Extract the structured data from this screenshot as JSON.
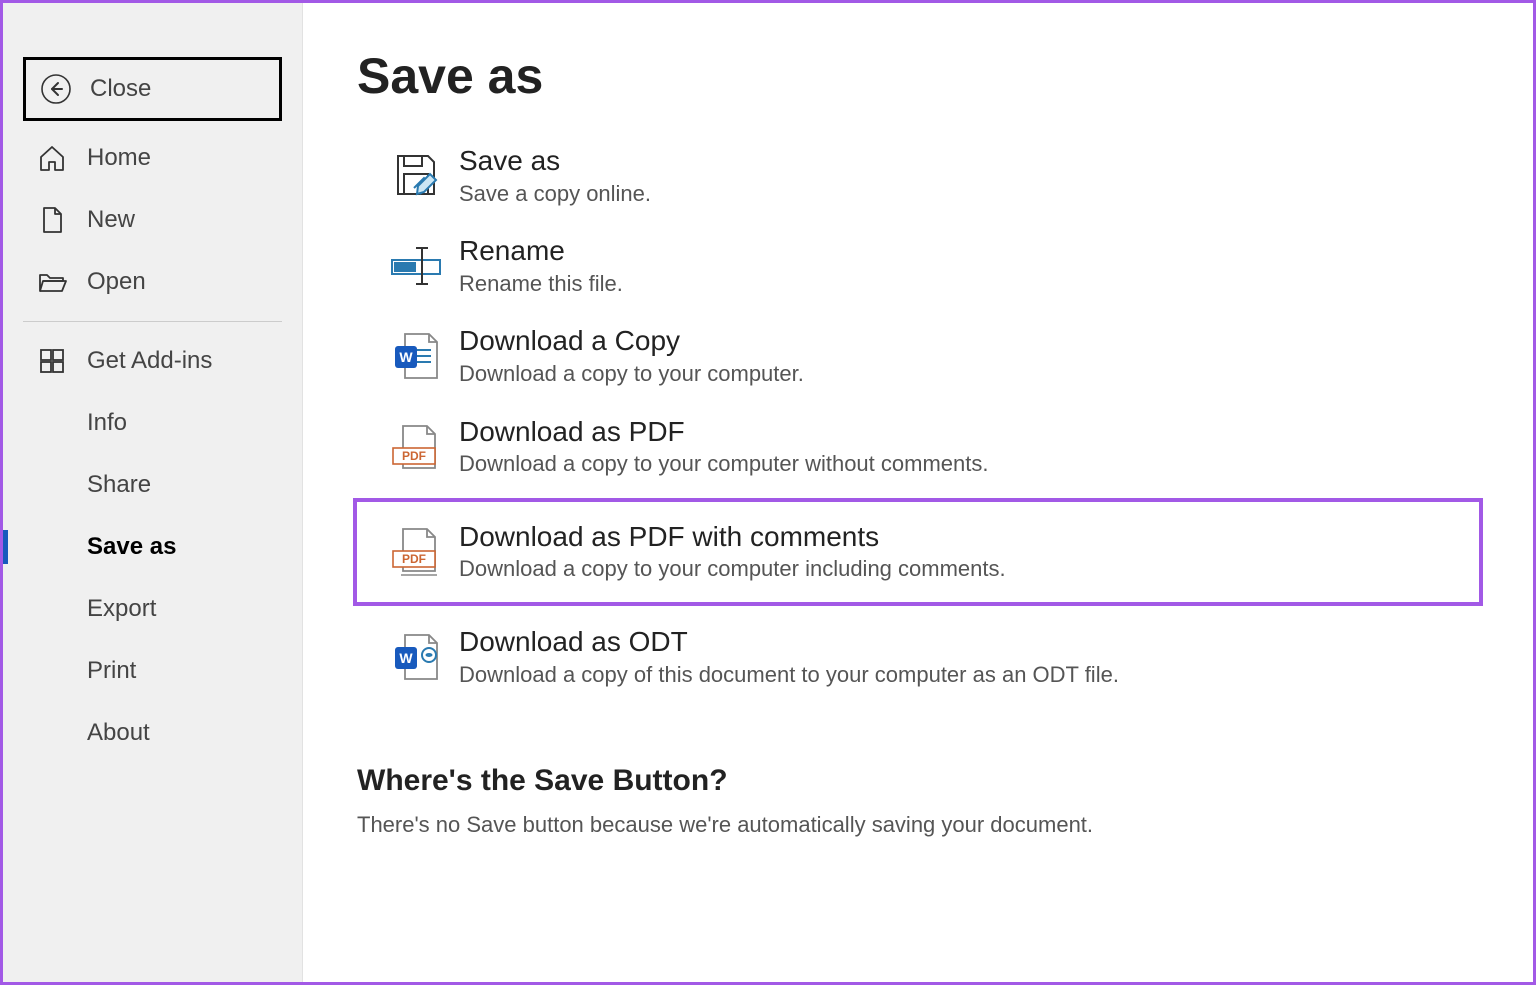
{
  "sidebar": {
    "close": "Close",
    "home": "Home",
    "new": "New",
    "open": "Open",
    "getAddins": "Get Add-ins",
    "info": "Info",
    "share": "Share",
    "saveAs": "Save as",
    "export": "Export",
    "print": "Print",
    "about": "About"
  },
  "page": {
    "title": "Save as"
  },
  "options": {
    "saveAs": {
      "title": "Save as",
      "desc": "Save a copy online."
    },
    "rename": {
      "title": "Rename",
      "desc": "Rename this file."
    },
    "downloadCopy": {
      "title": "Download a Copy",
      "desc": "Download a copy to your computer."
    },
    "downloadPdf": {
      "title": "Download as PDF",
      "desc": "Download a copy to your computer without comments."
    },
    "downloadPdfComments": {
      "title": "Download as PDF with comments",
      "desc": "Download a copy to your computer including comments."
    },
    "downloadOdt": {
      "title": "Download as ODT",
      "desc": "Download a copy of this document to your computer as an ODT file."
    }
  },
  "footer": {
    "heading": "Where's the Save Button?",
    "body": "There's no Save button because we're automatically saving your document."
  }
}
